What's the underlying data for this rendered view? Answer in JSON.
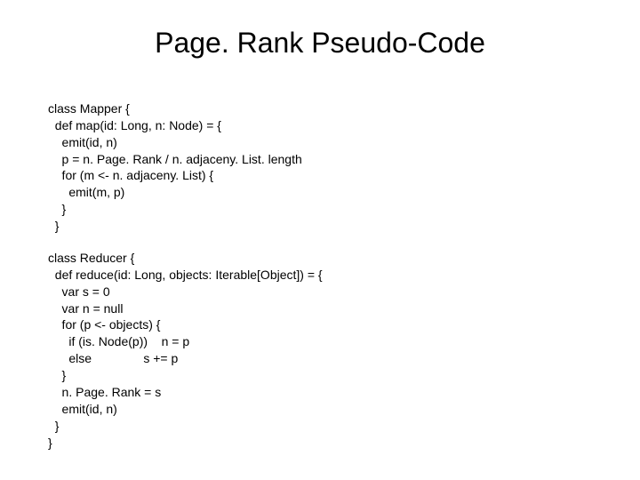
{
  "title": "Page. Rank Pseudo-Code",
  "mapper": {
    "l1": "class Mapper {",
    "l2": "  def map(id: Long, n: Node) = {",
    "l3": "    emit(id, n)",
    "l4": "    p = n. Page. Rank / n. adjaceny. List. length",
    "l5": "    for (m <- n. adjaceny. List) {",
    "l6": "      emit(m, p)",
    "l7": "    }",
    "l8": "  }"
  },
  "reducer": {
    "l1": "class Reducer {",
    "l2": "  def reduce(id: Long, objects: Iterable[Object]) = {",
    "l3": "    var s = 0",
    "l4": "    var n = null",
    "l5": "    for (p <- objects) {",
    "l6": "      if (is. Node(p))    n = p",
    "l7": "      else               s += p",
    "l8": "    }",
    "l9": "    n. Page. Rank = s",
    "l10": "    emit(id, n)",
    "l11": "  }",
    "l12": "}"
  }
}
